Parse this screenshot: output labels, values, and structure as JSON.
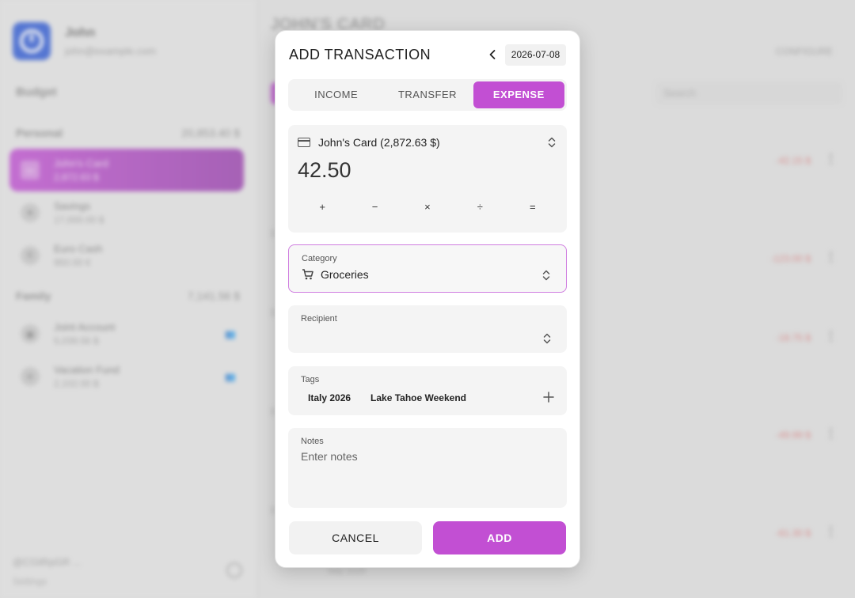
{
  "background": {
    "profile": {
      "name": "John",
      "email": "john@example.com"
    },
    "budget_label": "Budget",
    "groups": [
      {
        "name": "Personal",
        "total": "20,853.40 $"
      },
      {
        "name": "Family",
        "total": "7,141.56 $"
      }
    ],
    "accounts": [
      {
        "name": "John's Card",
        "balance": "2,872.63 $"
      },
      {
        "name": "Savings",
        "balance": "17,000.00 $"
      },
      {
        "name": "Euro Cash",
        "balance": "950.00 €"
      },
      {
        "name": "Joint Account",
        "balance": "5,039.56 $"
      },
      {
        "name": "Vacation Fund",
        "balance": "2,102.00 $"
      }
    ],
    "footer": {
      "line": "@CGtRpGR ...",
      "settings": "Settings"
    },
    "main_title": "JOHN'S CARD",
    "configure": "CONFIGURE",
    "search_placeholder": "Search",
    "row_amounts": [
      "-42.15 $",
      "-123.00 $",
      "-18.75 $",
      "-49.99 $",
      "-61.30 $"
    ],
    "bottom_tag": "Italy 2026"
  },
  "dialog": {
    "title": "ADD TRANSACTION",
    "date": "2026-07-08",
    "tabs": [
      {
        "label": "INCOME",
        "active": false
      },
      {
        "label": "TRANSFER",
        "active": false
      },
      {
        "label": "EXPENSE",
        "active": true
      }
    ],
    "account": "John's Card (2,872.63 $)",
    "amount": "42.50",
    "operators": [
      "+",
      "−",
      "×",
      "÷",
      "="
    ],
    "category": {
      "label": "Category",
      "value": "Groceries",
      "icon": "cart-icon"
    },
    "recipient": {
      "label": "Recipient",
      "value": ""
    },
    "tags": {
      "label": "Tags",
      "items": [
        "Italy 2026",
        "Lake Tahoe Weekend"
      ]
    },
    "notes": {
      "label": "Notes",
      "placeholder": "Enter notes"
    },
    "cancel_label": "CANCEL",
    "add_label": "ADD"
  },
  "colors": {
    "accent": "#c24fd3",
    "focus_border": "#cf7de0"
  }
}
